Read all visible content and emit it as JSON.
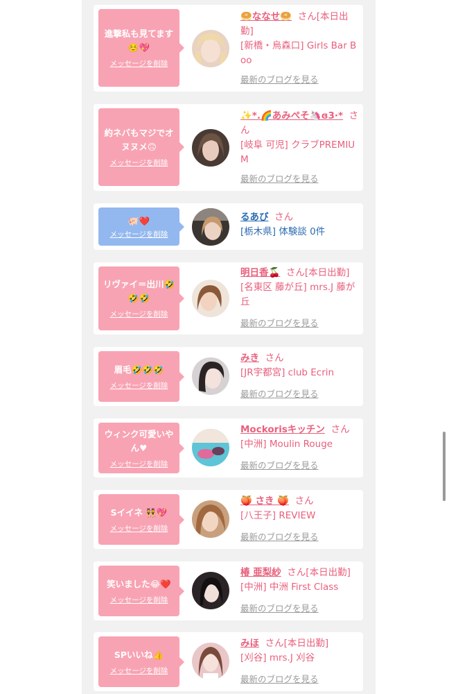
{
  "palette": {
    "accent": "#e95f7c",
    "bubble_pink": "#f8a3b3",
    "bubble_blue": "#93b8ef",
    "link_blue": "#2b6cb0",
    "muted": "#9a9a9a",
    "background": "#f1f1f1"
  },
  "common": {
    "delete_label": "メッセージを削除",
    "blog_label": "最新のブログを見る"
  },
  "cards": [
    {
      "message": "進撃私も見てます☺️💖",
      "name": "🥯ななせ🥯",
      "suffix": "さん[本日出勤]",
      "details": "[新橋・烏森口] Girls Bar Boo"
    },
    {
      "message": "約ネバもマジでオヌヌメ🙃",
      "name": "✨*.🌈あみぺそ🦄ɞ3·*",
      "suffix": "さん",
      "details": "[岐阜 可児] クラブPREMIUM"
    },
    {
      "message": "🐖❤️",
      "name": "るあび",
      "suffix": "さん",
      "details": "[栃木県] 体験談 0件"
    },
    {
      "message": "リヴァイ＝出川🤣🤣🤣",
      "name": "明日香🍒",
      "suffix": "さん[本日出勤]",
      "details": "[名東区 藤が丘] mrs.J 藤が丘"
    },
    {
      "message": "眉毛🤣🤣🤣",
      "name": "みき",
      "suffix": "さん",
      "details": "[JR宇都宮] club Ecrin"
    },
    {
      "message": "ウィンク可愛いやん♥",
      "name": "Mockorisキッチン",
      "suffix": "さん",
      "details": "[中洲] Moulin Rouge"
    },
    {
      "message": "Sイイネ 👯💖",
      "name": "🍑 さき 🍑",
      "suffix": "さん",
      "details": "[八王子] REVIEW"
    },
    {
      "message": "笑いました😂❤️",
      "name": "椿 亜梨紗",
      "suffix": "さん[本日出勤]",
      "details": "[中洲] 中洲 First Class"
    },
    {
      "message": "SPいいね👍",
      "name": "みほ",
      "suffix": "さん[本日出勤]",
      "details": "[刈谷] mrs.J 刈谷"
    }
  ]
}
